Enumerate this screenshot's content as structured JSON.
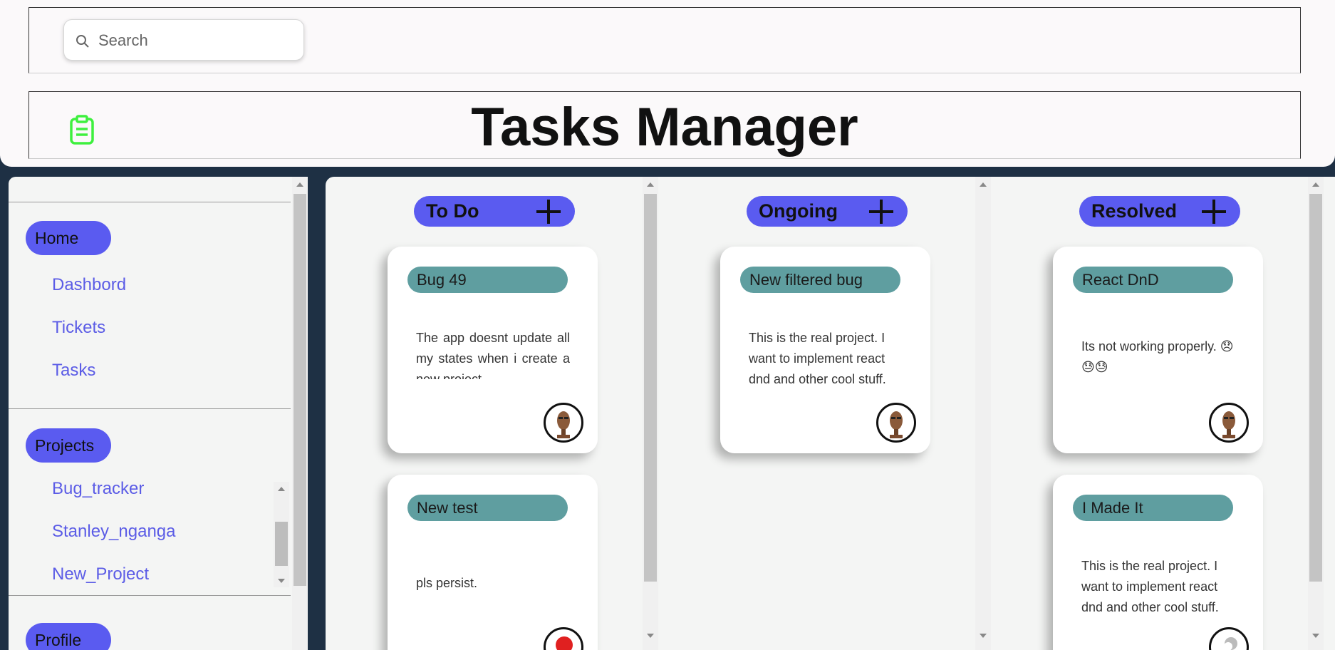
{
  "search": {
    "placeholder": "Search"
  },
  "header": {
    "title": "Tasks Manager"
  },
  "sidebar": {
    "home_label": "Home",
    "home_links": [
      "Dashbord",
      "Tickets",
      "Tasks"
    ],
    "projects_label": "Projects",
    "project_links": [
      "Bug_tracker",
      "Stanley_nganga",
      "New_Project"
    ],
    "profile_label": "Profile"
  },
  "columns": [
    {
      "title": "To Do",
      "cards": [
        {
          "tag": "Bug 49",
          "description": "The app doesnt update all my states when i create a new project."
        },
        {
          "tag": "New test",
          "description": "pls persist."
        }
      ]
    },
    {
      "title": "Ongoing",
      "cards": [
        {
          "tag": "New filtered bug",
          "description": "This is the real project. I want to implement react dnd and other cool stuff."
        }
      ]
    },
    {
      "title": "Resolved",
      "cards": [
        {
          "tag": "React DnD",
          "description": "Its not working properly. 😞😓😓"
        },
        {
          "tag": "I Made It",
          "description": "This is the real project. I want to implement react dnd and other cool stuff."
        }
      ]
    }
  ],
  "colors": {
    "accent": "#5a5bf0",
    "tag": "#5f9ea0",
    "link": "#5b5ce6",
    "logo": "#3ef03e"
  }
}
